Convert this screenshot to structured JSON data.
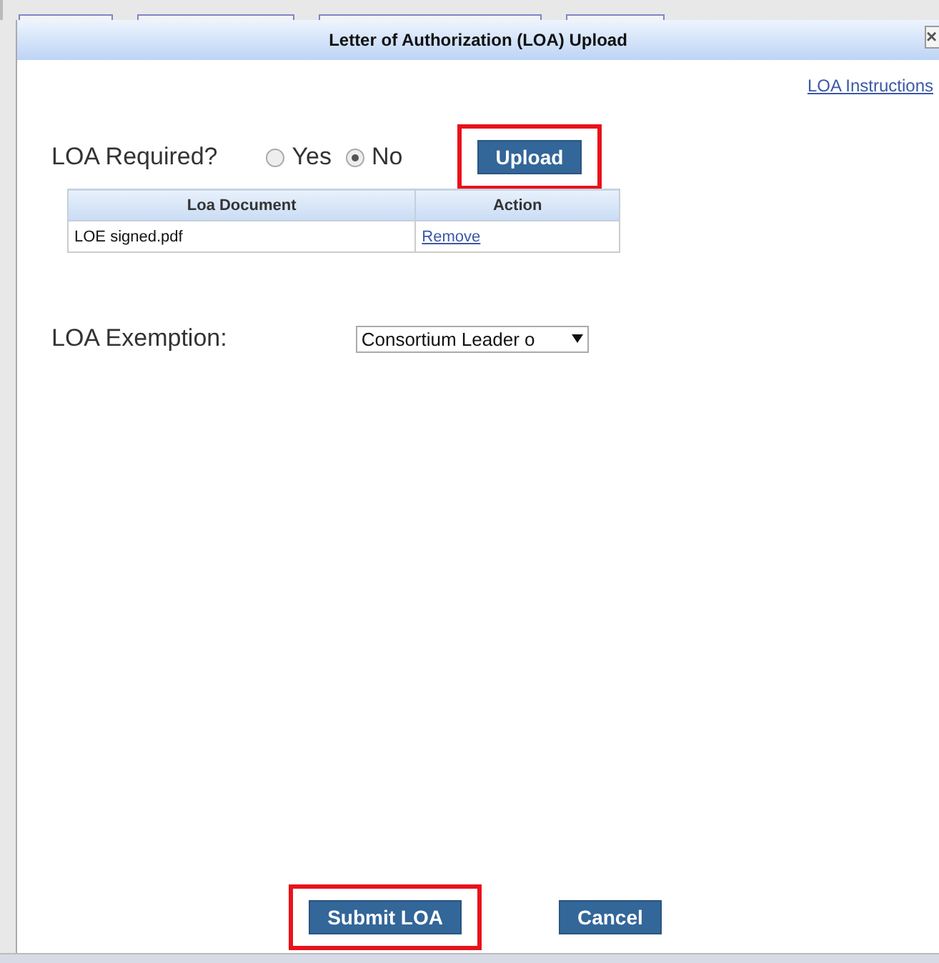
{
  "dialog": {
    "title": "Letter of Authorization (LOA) Upload",
    "close_icon": "×"
  },
  "instructions_link": "LOA Instructions",
  "loa_required": {
    "label": "LOA Required?",
    "options": [
      {
        "label": "Yes",
        "selected": false
      },
      {
        "label": "No",
        "selected": true
      }
    ]
  },
  "upload_button": {
    "label": "Upload",
    "highlighted": true
  },
  "table": {
    "columns": [
      "Loa Document",
      "Action"
    ],
    "rows": [
      {
        "document": "LOE signed.pdf",
        "action": "Remove"
      }
    ]
  },
  "exemption": {
    "label": "LOA Exemption:",
    "value": "Consortium Leader o"
  },
  "buttons": [
    {
      "label": "Submit LOA",
      "highlighted": true
    },
    {
      "label": "Cancel",
      "highlighted": false
    }
  ]
}
